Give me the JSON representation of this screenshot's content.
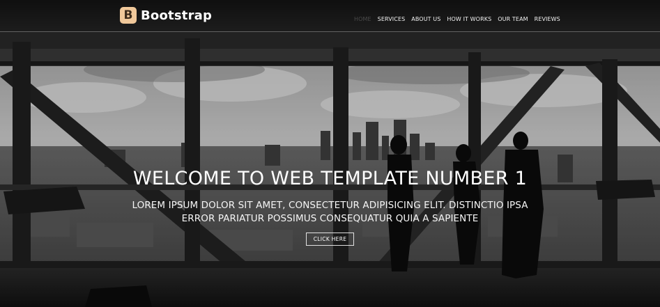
{
  "navbar": {
    "brand_letter": "B",
    "brand_name": "Bootstrap",
    "links": [
      {
        "label": "HOME",
        "active": true
      },
      {
        "label": "SERVICES",
        "active": false
      },
      {
        "label": "ABOUT US",
        "active": false
      },
      {
        "label": "HOW IT WORKS",
        "active": false
      },
      {
        "label": "OUR TEAM",
        "active": false
      },
      {
        "label": "REVIEWS",
        "active": false
      }
    ]
  },
  "hero": {
    "title": "WELCOME TO WEB TEMPLATE NUMBER 1",
    "subtitle": "LOREM IPSUM DOLOR SIT AMET, CONSECTETUR ADIPISICING ELIT. DISTINCTIO IPSA ERROR PARIATUR POSSIMUS CONSEQUATUR QUIA A SAPIENTE",
    "button_label": "CLICK HERE",
    "background": "black-and-white office window view of city skyline with silhouetted people"
  },
  "colors": {
    "brand_icon_bg": "#f0c89a",
    "nav_text": "#f2f2f2",
    "nav_active_text": "#4a4a4a",
    "hero_text": "#ffffff"
  }
}
